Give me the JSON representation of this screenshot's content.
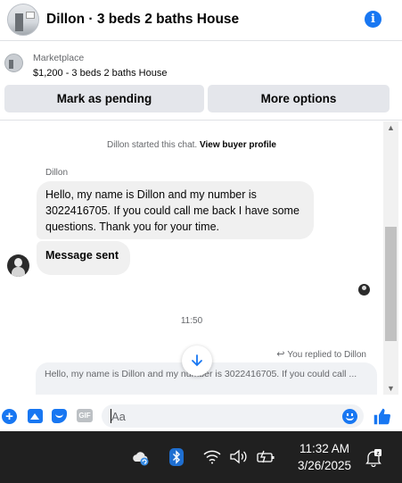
{
  "header": {
    "title": "Dillon · 3 beds 2 baths House",
    "info_icon": "info-icon"
  },
  "listing": {
    "source": "Marketplace",
    "price_title": "$1,200 - 3 beds 2 baths House"
  },
  "actions": {
    "mark_pending": "Mark as pending",
    "more_options": "More options"
  },
  "chat": {
    "system_prefix": "Dillon started this chat.",
    "system_link": "View buyer profile",
    "sender_name": "Dillon",
    "messages": [
      {
        "from": "Dillon",
        "text": "Hello, my name is Dillon and my number is 3022416705. If you could call me back I have some questions. Thank you for your time."
      },
      {
        "from": "Dillon",
        "text": "Message sent"
      }
    ],
    "timestamp": "11:50",
    "replied_label": "You replied to Dillon",
    "quoted_text": "Hello, my name is Dillon and my number is 3022416705. If you could call ..."
  },
  "composer": {
    "placeholder": "Aa",
    "gif_label": "GIF"
  },
  "taskbar": {
    "time": "11:32 AM",
    "date": "3/26/2025"
  },
  "colors": {
    "accent": "#1877f2",
    "bubble": "#f0f0f0",
    "button": "#e4e6eb",
    "taskbar": "#202020"
  }
}
